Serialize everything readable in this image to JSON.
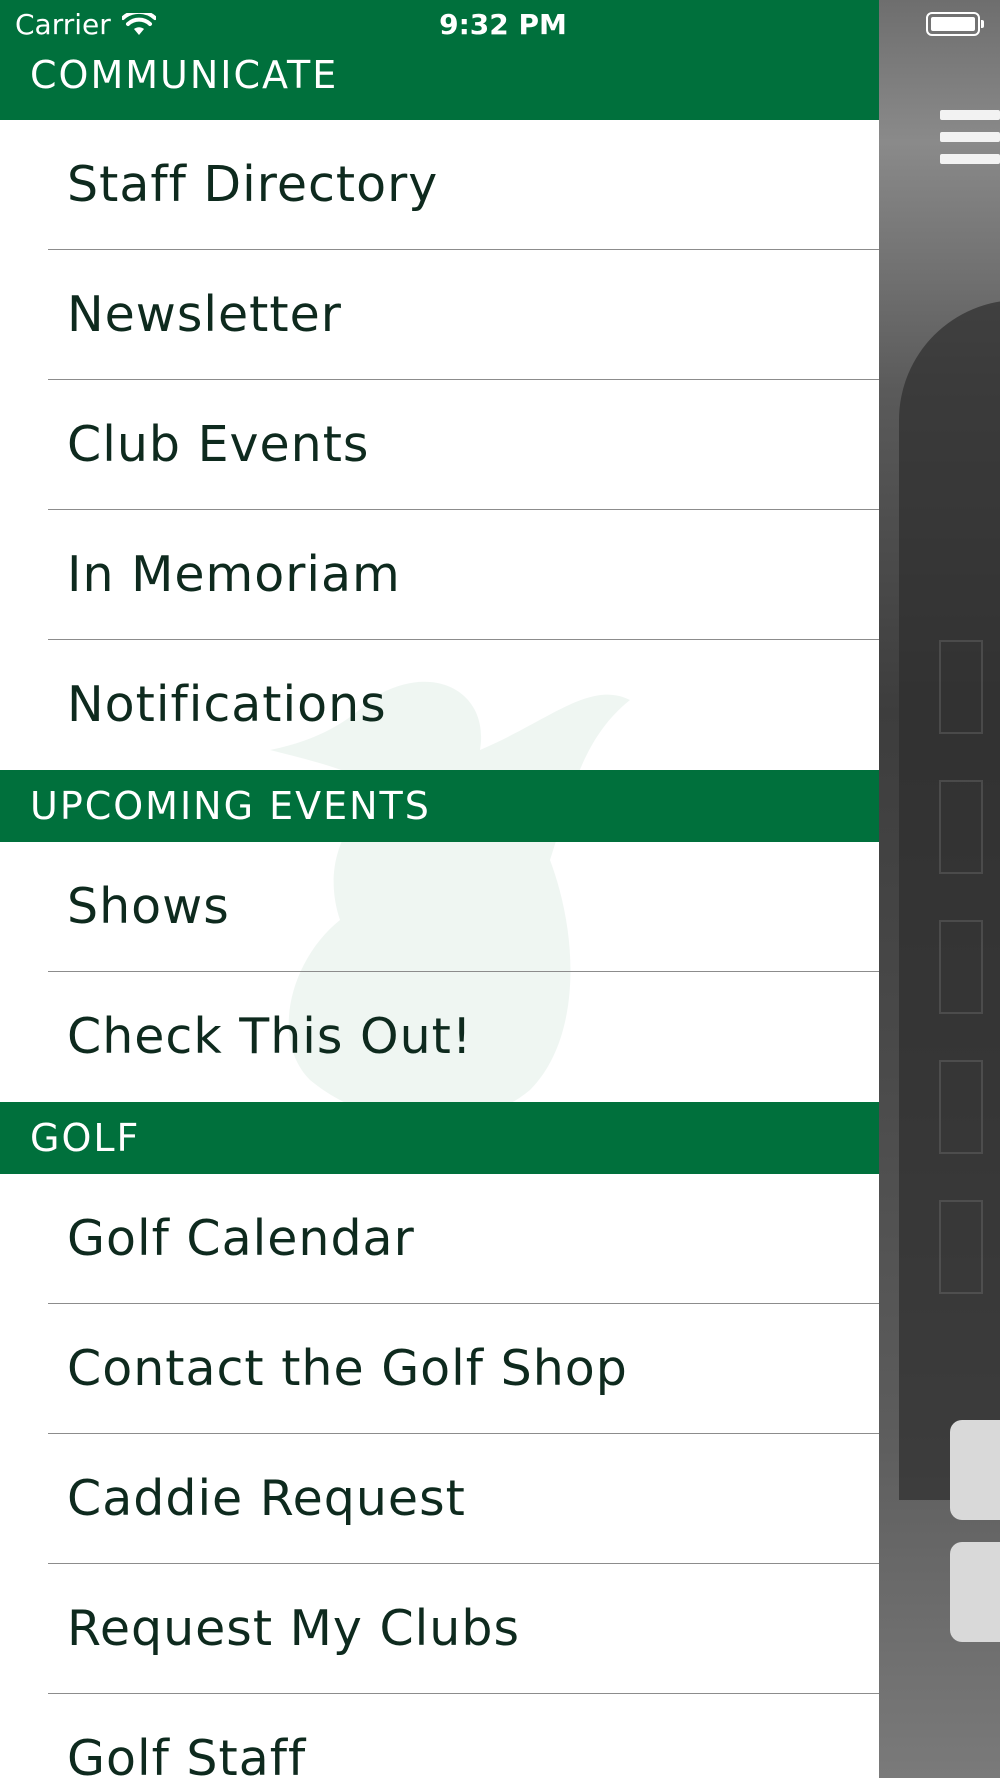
{
  "status_bar": {
    "carrier": "Carrier",
    "time": "9:32 PM"
  },
  "colors": {
    "brand_green": "#00703c",
    "menu_text": "#0e2a1e"
  },
  "icons": {
    "wifi": "wifi-icon",
    "battery": "battery-icon",
    "menu": "hamburger-menu-icon"
  },
  "drawer": {
    "sections": [
      {
        "header": "COMMUNICATE",
        "items": [
          "Staff Directory",
          "Newsletter",
          "Club Events",
          "In Memoriam",
          "Notifications"
        ]
      },
      {
        "header": "UPCOMING EVENTS",
        "items": [
          "Shows",
          "Check This Out!"
        ]
      },
      {
        "header": "GOLF",
        "items": [
          "Golf Calendar",
          "Contact the Golf Shop",
          "Caddie Request",
          "Request My Clubs",
          "Golf Staff"
        ]
      }
    ]
  }
}
